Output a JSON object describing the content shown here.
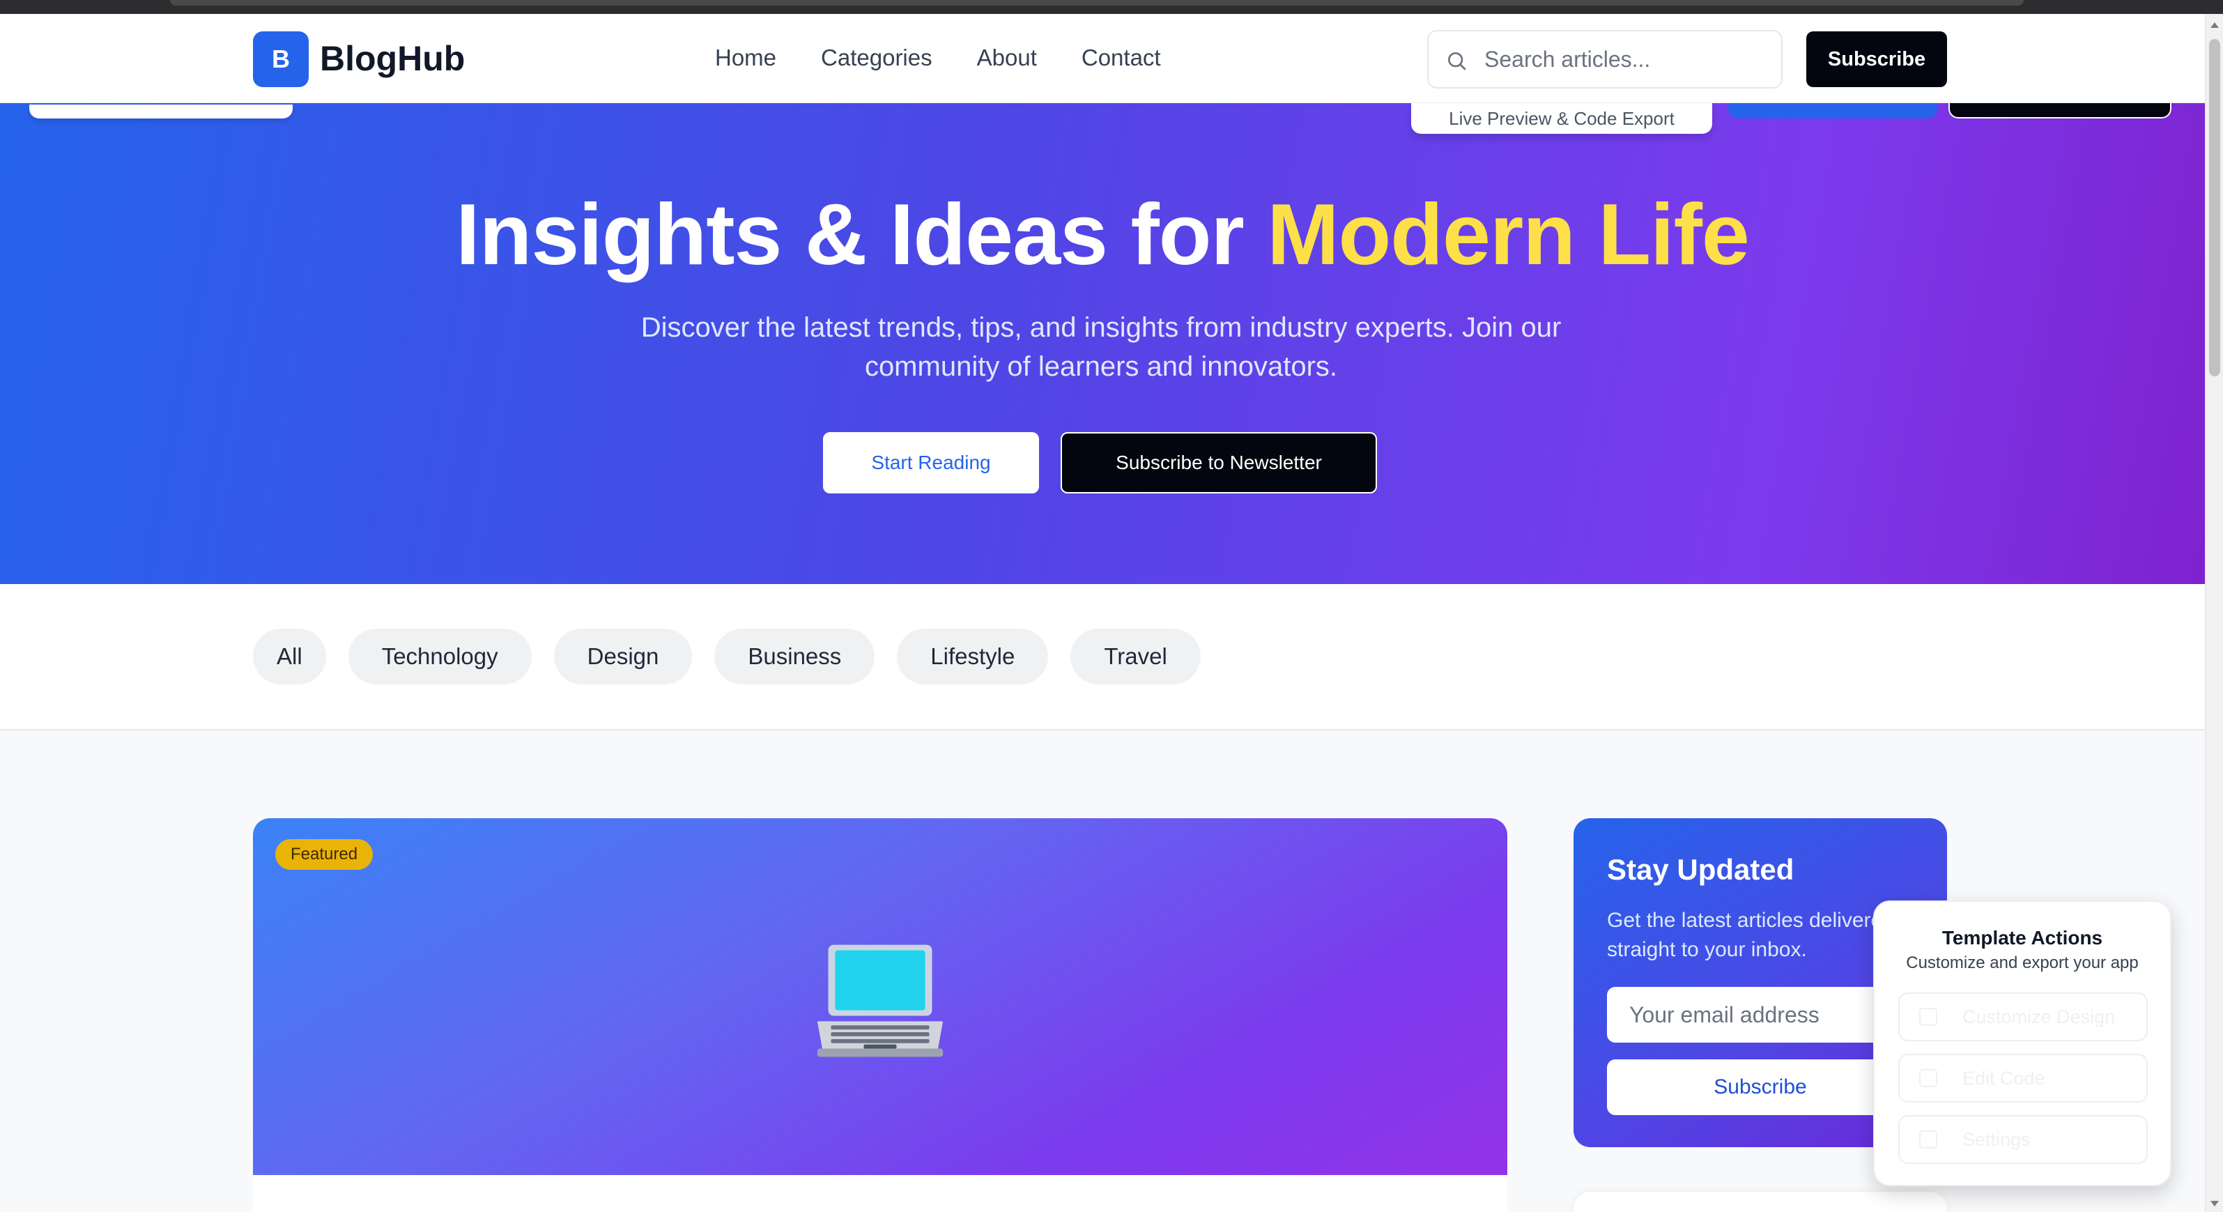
{
  "nav": {
    "logo_letter": "B",
    "brand": "BlogHub",
    "links": [
      "Home",
      "Categories",
      "About",
      "Contact"
    ],
    "search_placeholder": "Search articles...",
    "subscribe_label": "Subscribe"
  },
  "overlay": {
    "preview_label": "Live Preview & Code Export"
  },
  "hero": {
    "title_main": "Insights & Ideas for ",
    "title_accent": "Modern Life",
    "subtitle": "Discover the latest trends, tips, and insights from industry experts. Join our community of learners and innovators.",
    "start_label": "Start Reading",
    "newsletter_label": "Subscribe to Newsletter"
  },
  "categories": [
    "All",
    "Technology",
    "Design",
    "Business",
    "Lifestyle",
    "Travel"
  ],
  "featured": {
    "badge": "Featured",
    "icon": "laptop-icon"
  },
  "sidebar": {
    "title": "Stay Updated",
    "text": "Get the latest articles delivered straight to your inbox.",
    "email_placeholder": "Your email address",
    "subscribe_label": "Subscribe"
  },
  "template_actions": {
    "title": "Template Actions",
    "subtitle": "Customize and export your app",
    "buttons": [
      "Customize Design",
      "Edit Code",
      "Settings"
    ]
  },
  "colors": {
    "primary": "#2563eb",
    "accent": "#fde047",
    "dark": "#03060f",
    "badge": "#eab308"
  }
}
